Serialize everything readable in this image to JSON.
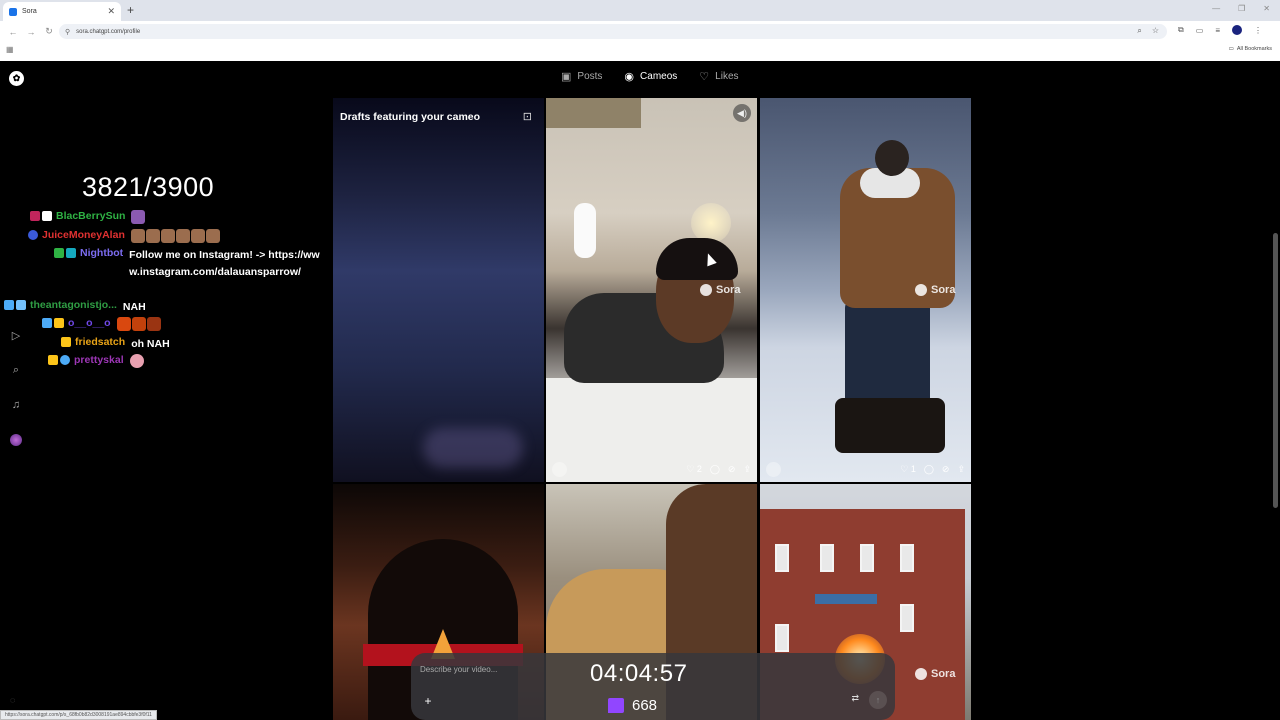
{
  "browser": {
    "tab_title": "Sora",
    "url": "sora.chatgpt.com/profile",
    "all_bookmarks": "All Bookmarks",
    "status_url": "https://sora.chatgpt.com/p/s_68fb0b82d3008191ae894cbbfe3f0f11"
  },
  "profile_tabs": [
    {
      "label": "Posts",
      "icon": "play-square-icon"
    },
    {
      "label": "Cameos",
      "icon": "person-circle-icon"
    },
    {
      "label": "Likes",
      "icon": "heart-icon"
    }
  ],
  "grid": {
    "drafts_title": "Drafts featuring your cameo",
    "watermark": "Sora",
    "cards": [
      {
        "likes": "2"
      },
      {
        "likes": "1"
      }
    ]
  },
  "composer": {
    "placeholder": "Describe your video..."
  },
  "stream": {
    "counter": "3821/3900",
    "timer": "04:04:57",
    "viewers": "668",
    "chat": [
      {
        "user": "BlacBerrySun",
        "color": "#2fb344",
        "text": ""
      },
      {
        "user": "JuiceMoneyAlan",
        "color": "#e03131",
        "text": ""
      },
      {
        "user": "Nightbot",
        "color": "#7c6cf0",
        "text": "Follow me on Instagram! -> https://www.instagram.com/dalauansparrow/"
      },
      {
        "user": "theantagonistjo...",
        "color": "#2f9e44",
        "text": "NAH"
      },
      {
        "user": "o__o__o",
        "color": "#7048e8",
        "text": ""
      },
      {
        "user": "friedsatch",
        "color": "#e8a317",
        "text": "oh NAH"
      },
      {
        "user": "prettyskal",
        "color": "#9c36b5",
        "text": ""
      }
    ]
  }
}
